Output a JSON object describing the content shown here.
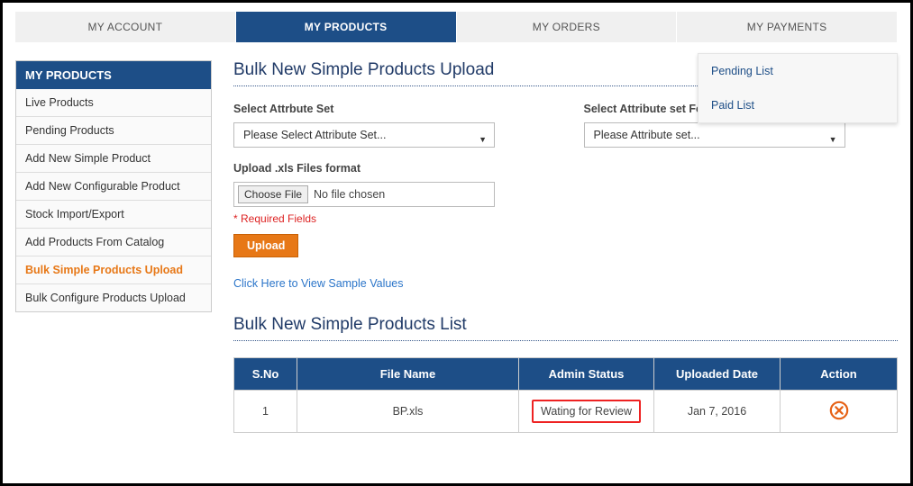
{
  "topnav": {
    "tabs": [
      {
        "label": "MY ACCOUNT"
      },
      {
        "label": "MY PRODUCTS"
      },
      {
        "label": "MY ORDERS"
      },
      {
        "label": "MY PAYMENTS"
      }
    ]
  },
  "payments_dropdown": {
    "items": [
      {
        "label": "Pending List"
      },
      {
        "label": "Paid List"
      }
    ]
  },
  "sidebar": {
    "header": "MY PRODUCTS",
    "items": [
      {
        "label": "Live Products"
      },
      {
        "label": "Pending Products"
      },
      {
        "label": "Add New Simple Product"
      },
      {
        "label": "Add New Configurable Product"
      },
      {
        "label": "Stock Import/Export"
      },
      {
        "label": "Add Products From Catalog"
      },
      {
        "label": "Bulk Simple Products Upload"
      },
      {
        "label": "Bulk Configure Products Upload"
      }
    ]
  },
  "page": {
    "title": "Bulk New Simple Products Upload",
    "attr_label": "Select Attrbute Set",
    "attr_select_text": "Please Select Attribute Set...",
    "sample_label": "Select Attribute set For Download Sample CSV File",
    "sample_select_text": "Please Attribute set...",
    "upload_label": "Upload .xls Files format",
    "choose_file_btn": "Choose File",
    "no_file_text": "No file chosen",
    "required_text": "* Required Fields",
    "upload_btn": "Upload",
    "sample_link": "Click Here to View Sample Values",
    "list_title": "Bulk New Simple Products List"
  },
  "table": {
    "headers": {
      "sno": "S.No",
      "filename": "File Name",
      "status": "Admin Status",
      "date": "Uploaded Date",
      "action": "Action"
    },
    "rows": [
      {
        "sno": "1",
        "filename": "BP.xls",
        "status": "Wating for Review",
        "date": "Jan 7, 2016"
      }
    ]
  }
}
